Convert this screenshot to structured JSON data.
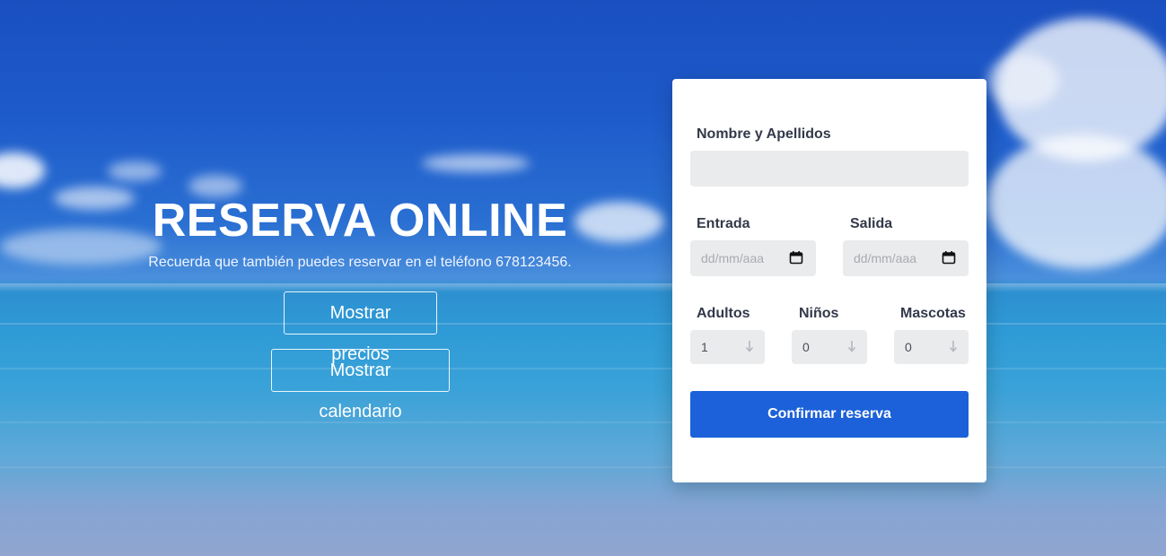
{
  "hero": {
    "title": "RESERVA ONLINE",
    "subtitle": "Recuerda que también puedes reservar en el teléfono 678123456.",
    "prices_button": "Mostrar precios",
    "calendar_button": "Mostrar calendario"
  },
  "form": {
    "name_label": "Nombre y Apellidos",
    "name_value": "",
    "checkin_label": "Entrada",
    "checkin_placeholder": "dd/mm/aaaa",
    "checkout_label": "Salida",
    "checkout_placeholder": "dd/mm/aaaa",
    "adults_label": "Adultos",
    "adults_value": "1",
    "children_label": "Niños",
    "children_value": "0",
    "pets_label": "Mascotas",
    "pets_value": "0",
    "submit_label": "Confirmar reserva",
    "icons": {
      "date": "calendar-icon",
      "stepper": "arrow-down-icon"
    }
  },
  "colors": {
    "accent": "#1c61d9",
    "field_bg": "#eaebed",
    "label": "#33394a"
  }
}
